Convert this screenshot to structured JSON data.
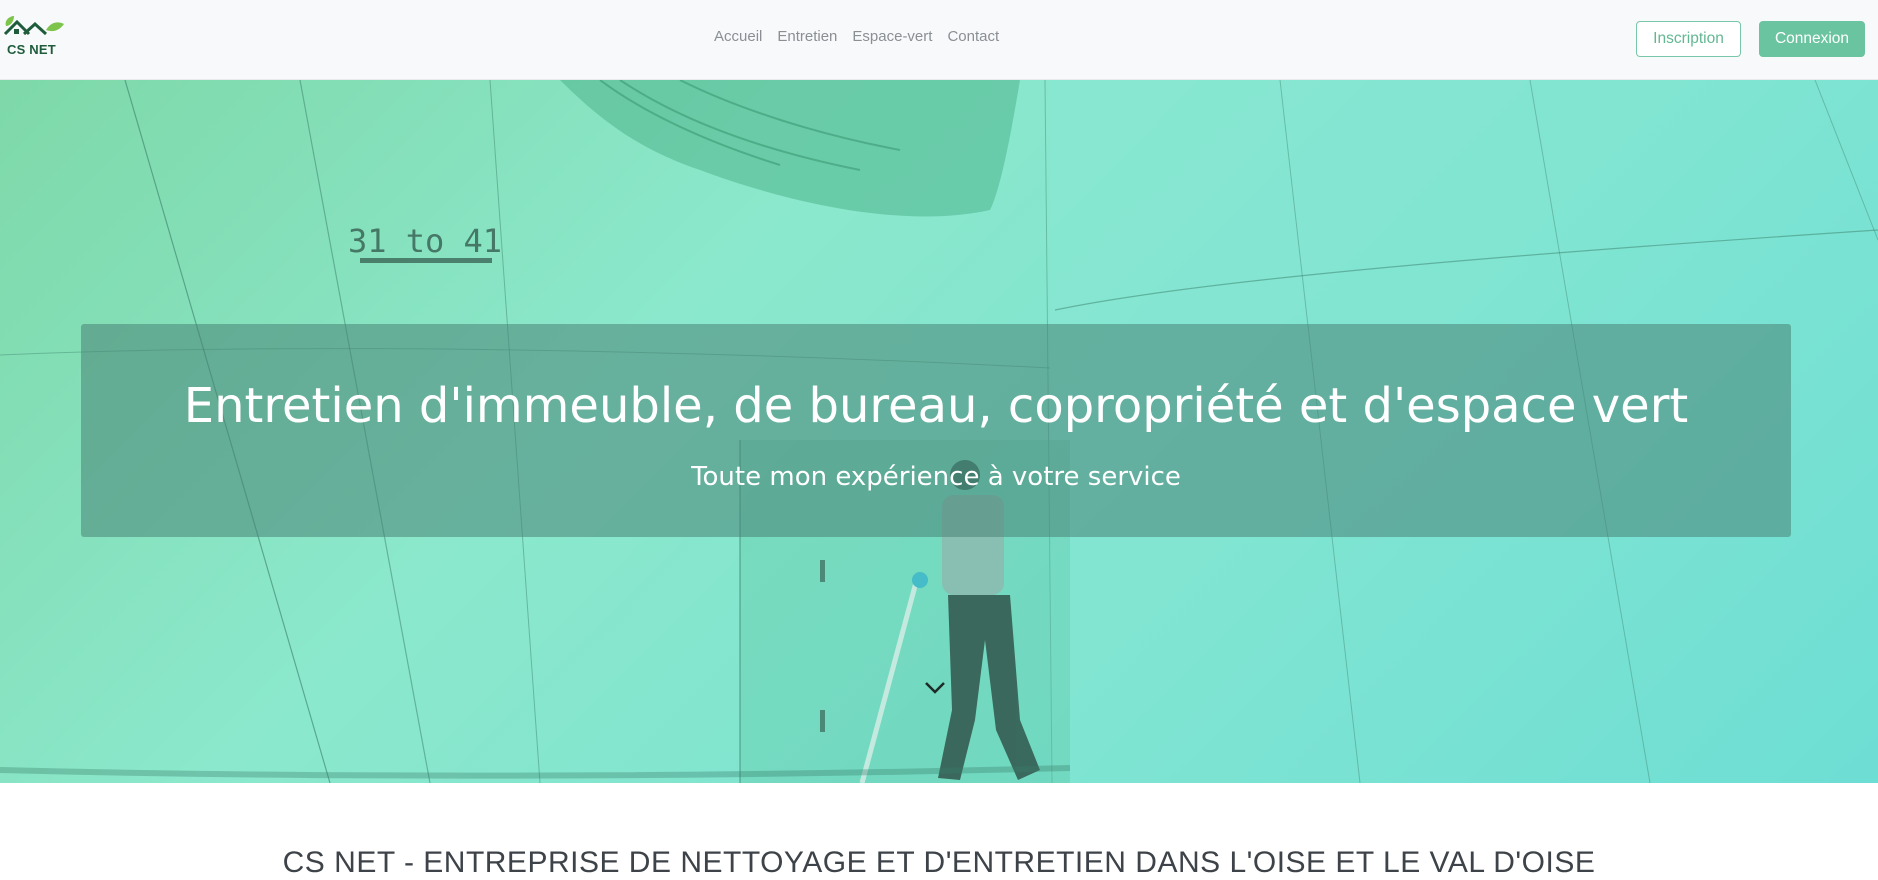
{
  "logo": {
    "text": "CS NET",
    "icon": "house-leaf-icon"
  },
  "nav": {
    "items": [
      {
        "label": "Accueil"
      },
      {
        "label": "Entretien"
      },
      {
        "label": "Espace-vert"
      },
      {
        "label": "Contact"
      }
    ]
  },
  "auth": {
    "signup_label": "Inscription",
    "login_label": "Connexion"
  },
  "hero": {
    "title": "Entretien d'immeuble, de bureau, copropriété et d'espace vert",
    "subtitle": "Toute mon expérience à votre service",
    "sign_text": "31 to 41",
    "scroll_icon": "chevron-down-icon"
  },
  "section": {
    "heading": "CS NET - ENTREPRISE DE NETTOYAGE ET D'ENTRETIEN DANS L'OISE ET LE VAL D'OISE"
  },
  "colors": {
    "brand_green": "#6bc4a0",
    "nav_bg": "#f8f9fa",
    "hero_overlay": "#488476"
  }
}
